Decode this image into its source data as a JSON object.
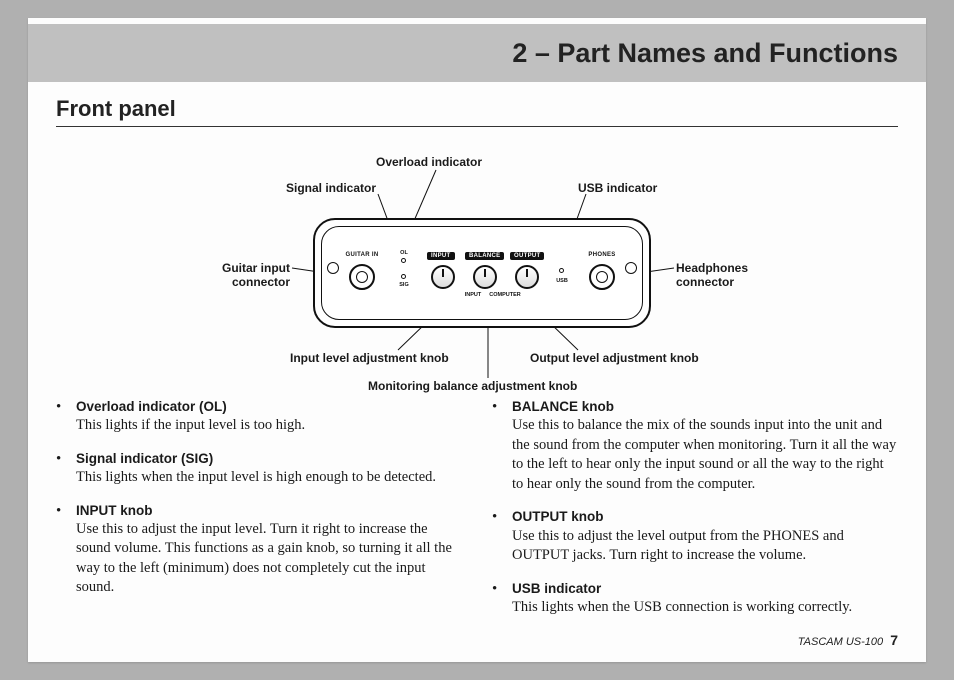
{
  "header": {
    "title": "2 – Part Names and Functions"
  },
  "section": {
    "title": "Front panel"
  },
  "callouts": {
    "overload": "Overload indicator",
    "signal": "Signal indicator",
    "usb": "USB indicator",
    "guitar_l1": "Guitar input",
    "guitar_l2": "connector",
    "phones_l1": "Headphones",
    "phones_l2": "connector",
    "input_knob": "Input level adjustment knob",
    "output_knob": "Output level adjustment knob",
    "balance_knob": "Monitoring balance adjustment knob"
  },
  "device": {
    "guitar_in": "GUITAR IN",
    "ol": "OL",
    "sig": "SIG",
    "input_tag": "INPUT",
    "balance_tag": "BALANCE",
    "output_tag": "OUTPUT",
    "input_sub": "INPUT",
    "computer_sub": "COMPUTER",
    "usb": "USB",
    "phones": "PHONES"
  },
  "left_items": [
    {
      "title": "Overload indicator (OL)",
      "desc": "This lights if the input level is too high."
    },
    {
      "title": "Signal indicator (SIG)",
      "desc": "This lights when the input level is high enough to be detected."
    },
    {
      "title": "INPUT knob",
      "desc": "Use this to adjust the input level. Turn it right to increase the sound volume. This functions as a gain knob, so turning it all the way to the left (minimum) does not completely cut the input sound."
    }
  ],
  "right_items": [
    {
      "title": "BALANCE knob",
      "desc": "Use this to balance the mix of the sounds input into the unit and the sound from the computer when monitoring. Turn it all the way to the left to hear only the input sound or all the way to the right to hear only the sound from the computer."
    },
    {
      "title": "OUTPUT knob",
      "desc": "Use this to adjust the level output from the PHONES and OUTPUT jacks. Turn right to increase the volume."
    },
    {
      "title": "USB indicator",
      "desc": "This lights when the USB connection is working correctly."
    }
  ],
  "footer": {
    "model": "TASCAM US-100",
    "page": "7"
  }
}
